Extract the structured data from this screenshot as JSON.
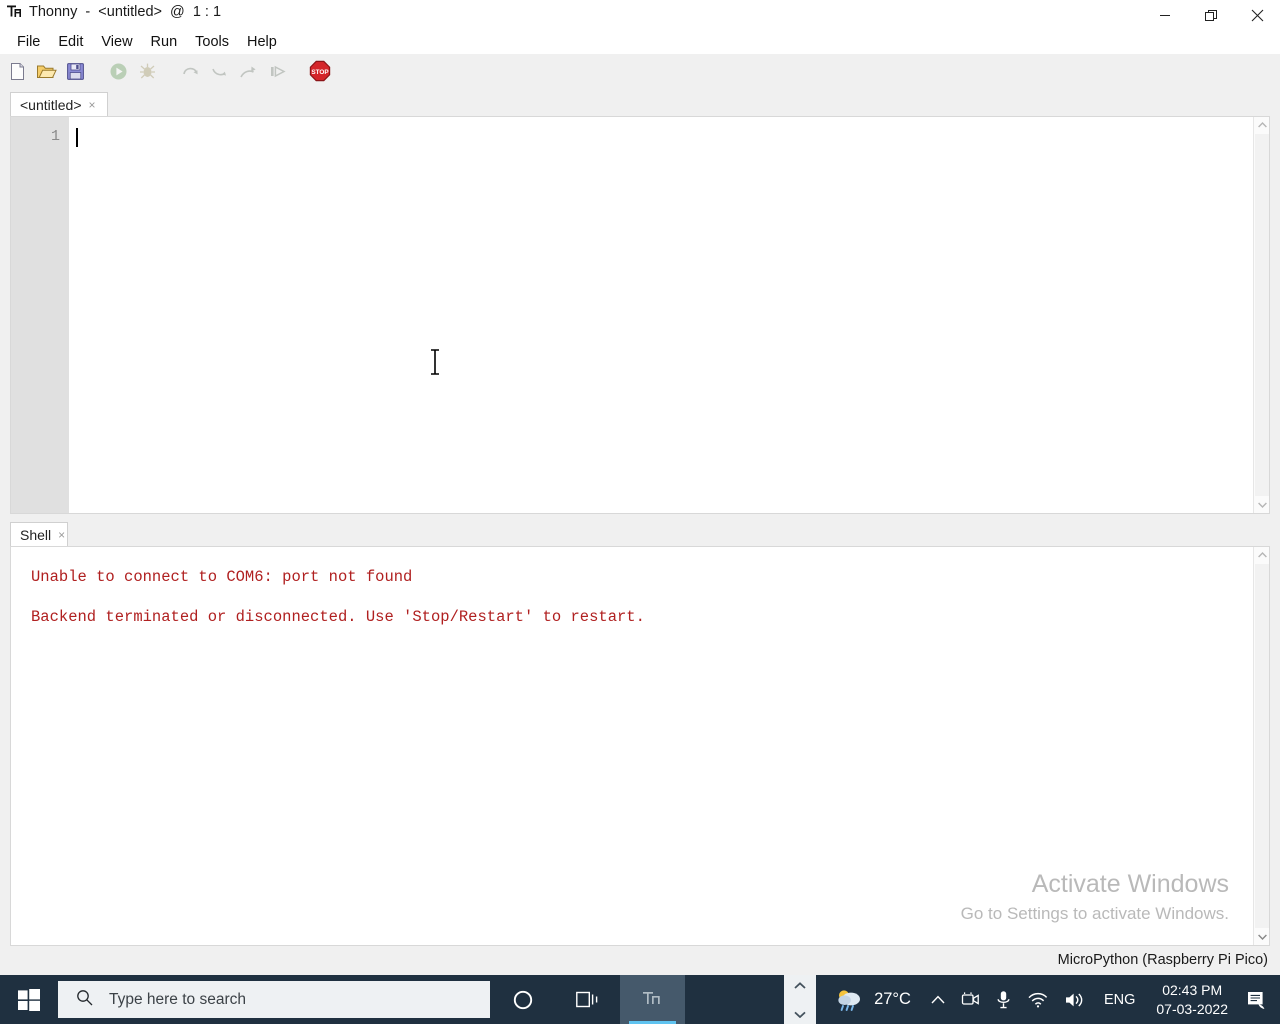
{
  "window": {
    "title": "Thonny  -  <untitled>  @  1 : 1",
    "app_icon": "thonny-logo-icon",
    "controls": {
      "minimize": "minimize-icon",
      "restore": "restore-icon",
      "close": "close-icon"
    }
  },
  "menubar": {
    "items": [
      {
        "label": "File"
      },
      {
        "label": "Edit"
      },
      {
        "label": "View"
      },
      {
        "label": "Run"
      },
      {
        "label": "Tools"
      },
      {
        "label": "Help"
      }
    ]
  },
  "toolbar": {
    "buttons": [
      {
        "name": "new-file-icon",
        "title": "New",
        "enabled": true
      },
      {
        "name": "open-file-icon",
        "title": "Open",
        "enabled": true
      },
      {
        "name": "save-file-icon",
        "title": "Save",
        "enabled": true
      },
      {
        "name": "run-icon",
        "title": "Run",
        "enabled": false
      },
      {
        "name": "debug-icon",
        "title": "Debug",
        "enabled": false
      },
      {
        "name": "step-over-icon",
        "title": "Step over",
        "enabled": false
      },
      {
        "name": "step-into-icon",
        "title": "Step into",
        "enabled": false
      },
      {
        "name": "step-out-icon",
        "title": "Step out",
        "enabled": false
      },
      {
        "name": "resume-icon",
        "title": "Resume",
        "enabled": false
      },
      {
        "name": "stop-icon",
        "title": "Stop/Restart backend",
        "enabled": true
      }
    ]
  },
  "editor": {
    "tab_label": "<untitled>",
    "tab_close": "×",
    "line_numbers": [
      "1"
    ],
    "content": "",
    "cursor_position": "1 : 1"
  },
  "shell": {
    "tab_label": "Shell",
    "tab_close": "×",
    "lines": [
      "Unable to connect to COM6: port not found",
      "Backend terminated or disconnected. Use 'Stop/Restart' to restart."
    ],
    "text_color": "#b02020"
  },
  "watermark": {
    "line1": "Activate Windows",
    "line2": "Go to Settings to activate Windows."
  },
  "statusbar": {
    "interpreter": "MicroPython (Raspberry Pi Pico)"
  },
  "taskbar": {
    "start_icon": "windows-logo-icon",
    "search": {
      "placeholder": "Type here to search",
      "icon": "search-icon"
    },
    "items": [
      {
        "name": "cortana-icon",
        "label": "Cortana",
        "active": false
      },
      {
        "name": "task-view-icon",
        "label": "Task View",
        "active": false
      },
      {
        "name": "thonny-taskbar-icon",
        "label": "Thonny",
        "active": true
      }
    ],
    "overflow": {
      "up": "chevron-up-icon",
      "down": "chevron-down-icon"
    },
    "tray": {
      "weather_icon": "weather-rain-icon",
      "temperature": "27°C",
      "show_hidden": "chevron-up-icon",
      "icons": [
        "camera-icon",
        "microphone-icon",
        "wifi-icon",
        "volume-icon"
      ],
      "language": "ENG",
      "time": "02:43 PM",
      "date": "07-03-2022",
      "notifications": "notifications-icon"
    }
  },
  "colors": {
    "accent": "#5fc3f0",
    "taskbar_bg": "#1f3040",
    "error_text": "#b02020",
    "gutter_bg": "#e0e0e0"
  }
}
